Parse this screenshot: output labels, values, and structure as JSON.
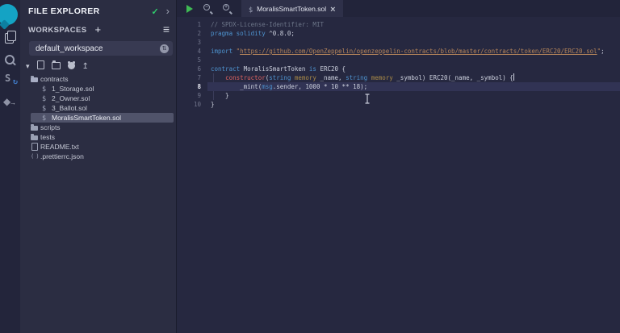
{
  "rail": {
    "items": [
      {
        "icon": "remix-logo",
        "interactable": false
      },
      {
        "icon": "file-explorer-icon",
        "interactable": true
      },
      {
        "icon": "search-icon",
        "interactable": true
      },
      {
        "icon": "solidity-compiler-icon",
        "interactable": true
      },
      {
        "icon": "deploy-run-icon",
        "interactable": true
      }
    ]
  },
  "file_explorer": {
    "title": "FILE EXPLORER",
    "workspaces_label": "WORKSPACES",
    "workspace_selected": "default_workspace",
    "actions": [
      {
        "icon": "caret-down-icon"
      },
      {
        "icon": "new-file-icon"
      },
      {
        "icon": "new-folder-icon"
      },
      {
        "icon": "github-icon"
      },
      {
        "icon": "upload-file-icon"
      }
    ],
    "tree": [
      {
        "type": "folder-open",
        "label": "contracts",
        "indent": 0,
        "selected": false
      },
      {
        "type": "sol",
        "label": "1_Storage.sol",
        "indent": 1,
        "selected": false
      },
      {
        "type": "sol",
        "label": "2_Owner.sol",
        "indent": 1,
        "selected": false
      },
      {
        "type": "sol",
        "label": "3_Ballot.sol",
        "indent": 1,
        "selected": false
      },
      {
        "type": "sol",
        "label": "MoralisSmartToken.sol",
        "indent": 1,
        "selected": true
      },
      {
        "type": "folder",
        "label": "scripts",
        "indent": 0,
        "selected": false
      },
      {
        "type": "folder",
        "label": "tests",
        "indent": 0,
        "selected": false
      },
      {
        "type": "file",
        "label": "README.txt",
        "indent": 0,
        "selected": false
      },
      {
        "type": "json",
        "label": ".prettierrc.json",
        "indent": 0,
        "selected": false
      }
    ]
  },
  "editor": {
    "tab": {
      "label": "MoralisSmartToken.sol"
    },
    "active_line": 8,
    "lines": [
      {
        "n": 1,
        "tokens": [
          {
            "t": "// SPDX-License-Identifier: MIT",
            "c": "comment"
          }
        ]
      },
      {
        "n": 2,
        "tokens": [
          {
            "t": "pragma",
            "c": "keyword"
          },
          {
            "t": " ",
            "c": "plain"
          },
          {
            "t": "solidity",
            "c": "keyword"
          },
          {
            "t": " ^0.8.0;",
            "c": "plain"
          }
        ]
      },
      {
        "n": 3,
        "tokens": []
      },
      {
        "n": 4,
        "tokens": [
          {
            "t": "import",
            "c": "keyword"
          },
          {
            "t": " ",
            "c": "plain"
          },
          {
            "t": "\"",
            "c": "str"
          },
          {
            "t": "https://github.com/OpenZeppelin/openzeppelin-contracts/blob/master/contracts/token/ERC20/ERC20.sol",
            "c": "strlink"
          },
          {
            "t": "\"",
            "c": "str"
          },
          {
            "t": ";",
            "c": "plain"
          }
        ]
      },
      {
        "n": 5,
        "tokens": []
      },
      {
        "n": 6,
        "tokens": [
          {
            "t": "contract",
            "c": "keyword"
          },
          {
            "t": " MoralisSmartToken ",
            "c": "plain"
          },
          {
            "t": "is",
            "c": "keyword"
          },
          {
            "t": " ERC20 {",
            "c": "plain"
          }
        ]
      },
      {
        "n": 7,
        "tokens": [
          {
            "t": "    ",
            "c": "plain"
          },
          {
            "t": "constructor",
            "c": "ctor"
          },
          {
            "t": "(",
            "c": "plain"
          },
          {
            "t": "string",
            "c": "keyword"
          },
          {
            "t": " ",
            "c": "plain"
          },
          {
            "t": "memory",
            "c": "mod"
          },
          {
            "t": " _name, ",
            "c": "plain"
          },
          {
            "t": "string",
            "c": "keyword"
          },
          {
            "t": " ",
            "c": "plain"
          },
          {
            "t": "memory",
            "c": "mod"
          },
          {
            "t": " _symbol) ERC20(_name, _symbol) {",
            "c": "plain"
          },
          {
            "t": "",
            "c": "caret"
          }
        ]
      },
      {
        "n": 8,
        "tokens": [
          {
            "t": "        _mint(",
            "c": "plain"
          },
          {
            "t": "msg",
            "c": "keyword"
          },
          {
            "t": ".sender, 1000 * 10 ** 18);",
            "c": "plain"
          }
        ]
      },
      {
        "n": 9,
        "tokens": [
          {
            "t": "    }",
            "c": "plain"
          }
        ]
      },
      {
        "n": 10,
        "tokens": [
          {
            "t": "}",
            "c": "plain"
          }
        ]
      }
    ]
  },
  "colors": {
    "logo_teal": "#14a3c4",
    "check_green": "#2fca6c",
    "play_green": "#3fbb54",
    "keyword_blue": "#4e93cf",
    "constructor_red": "#de6360",
    "memory_gold": "#ab8b47",
    "string_orange": "#b5855a",
    "comment_gray": "#6d7689",
    "selected_row": "#50536a",
    "active_line": "#313354",
    "panel_bg": "#2b2d42",
    "editor_bg": "#262840",
    "rail_bg": "#23253b"
  }
}
